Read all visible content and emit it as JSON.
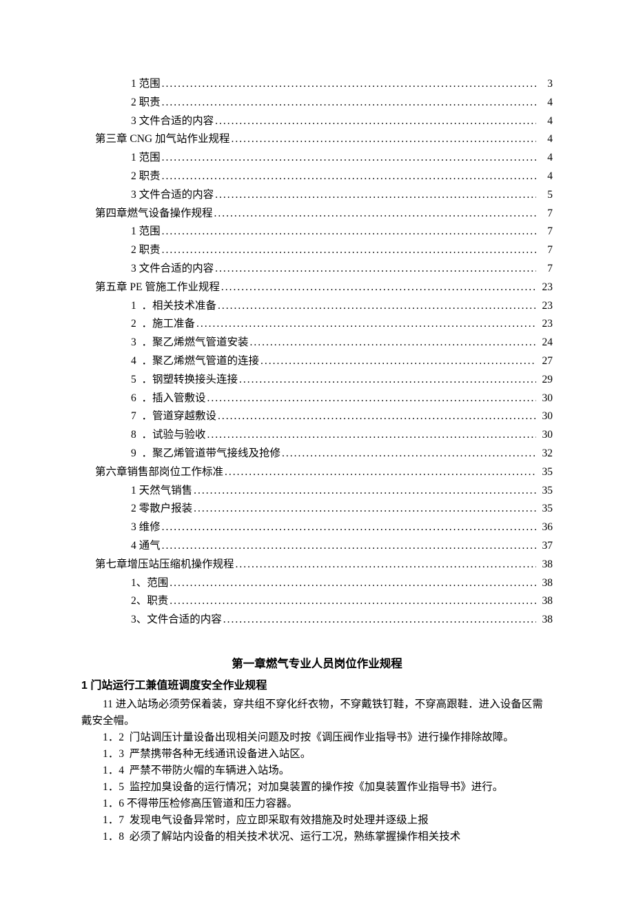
{
  "toc": [
    {
      "level": 1,
      "label": "1 范围",
      "page": "3"
    },
    {
      "level": 1,
      "label": "2 职责",
      "page": "4"
    },
    {
      "level": 1,
      "label": "3 文件合适的内容",
      "page": "4"
    },
    {
      "level": 0,
      "label": "第三章 CNG 加气站作业规程",
      "page": "4"
    },
    {
      "level": 1,
      "label": "1 范围",
      "page": "4"
    },
    {
      "level": 1,
      "label": "2 职责",
      "page": "4"
    },
    {
      "level": 1,
      "label": "3 文件合适的内容",
      "page": "5"
    },
    {
      "level": 0,
      "label": "第四章燃气设备操作规程",
      "page": "7"
    },
    {
      "level": 1,
      "label": "1 范围",
      "page": "7"
    },
    {
      "level": 1,
      "label": "2 职责",
      "page": "7"
    },
    {
      "level": 1,
      "label": "3 文件合适的内容",
      "page": "7"
    },
    {
      "level": 0,
      "label": "第五章 PE 管施工作业规程",
      "page": "23"
    },
    {
      "level": 1,
      "label": "1  ．相关技术准备",
      "page": "23"
    },
    {
      "level": 1,
      "label": "2  ．施工准备",
      "page": "23"
    },
    {
      "level": 1,
      "label": "3  ．聚乙烯燃气管道安装",
      "page": "24"
    },
    {
      "level": 1,
      "label": "4  ．聚乙烯燃气管道的连接",
      "page": "27"
    },
    {
      "level": 1,
      "label": "5  ．钢塑转换接头连接",
      "page": "29"
    },
    {
      "level": 1,
      "label": "6  ．插入管敷设",
      "page": "30"
    },
    {
      "level": 1,
      "label": "7  ．管道穿越敷设",
      "page": "30"
    },
    {
      "level": 1,
      "label": "8  ．试验与验收",
      "page": "30"
    },
    {
      "level": 1,
      "label": "9  ．聚乙烯管道带气接线及抢修",
      "page": "32"
    },
    {
      "level": 0,
      "label": "第六章销售部岗位工作标准",
      "page": "35"
    },
    {
      "level": 1,
      "label": "1 天然气销售",
      "page": "35"
    },
    {
      "level": 1,
      "label": "2 零散户报装",
      "page": "35"
    },
    {
      "level": 1,
      "label": "3 维修",
      "page": "36"
    },
    {
      "level": 1,
      "label": "4 通气",
      "page": "37"
    },
    {
      "level": 0,
      "label": "第七章增压站压缩机操作规程",
      "page": "38"
    },
    {
      "level": 1,
      "label": "1、范围",
      "page": "38"
    },
    {
      "level": 1,
      "label": "2、职责",
      "page": "38"
    },
    {
      "level": 1,
      "label": "3、文件合适的内容",
      "page": "38"
    }
  ],
  "body": {
    "chapter_title": "第一章燃气专业人员岗位作业规程",
    "section_heading": "1 门站运行工兼值班调度安全作业规程",
    "items": [
      "11 进入站场必须劳保着装，穿共组不穿化纤衣物，不穿戴铁钉鞋，不穿高跟鞋．进入设备区需戴安全帽。",
      "1．2  门站调压计量设备出现相关问题及时按《调压阀作业指导书》进行操作排除故障。",
      "1．3  严禁携带各种无线通讯设备进入站区。",
      "1．4  严禁不带防火帽的车辆进入站场。",
      "1．5  监控加臭设备的运行情况；对加臭装置的操作按《加臭装置作业指导书》进行。",
      "1．6 不得带压检修高压管道和压力容器。",
      "1．7  发现电气设备异常时，应立即采取有效措施及时处理并逐级上报",
      "1．8  必须了解站内设备的相关技术状况、运行工况，熟练掌握操作相关技术"
    ]
  }
}
